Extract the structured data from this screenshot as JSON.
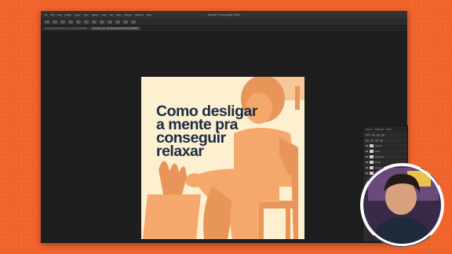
{
  "app": {
    "title": "Adobe Photoshop 2022",
    "menu": [
      "Ps",
      "File",
      "Edit",
      "Image",
      "Layer",
      "Type",
      "Select",
      "Filter",
      "3D",
      "View",
      "Plugins",
      "Window",
      "Help"
    ]
  },
  "tabs": [
    {
      "label": "Carrossel_Ansiedade_01.psd @ 50% (RGB/8)",
      "active": false
    },
    {
      "label": "carrossel_post_04_Relaxar.psd @ 33.3% (RGB/8)",
      "active": true
    }
  ],
  "artboard": {
    "headline": [
      "Como desligar",
      "a mente pra",
      "conseguir",
      "relaxar"
    ],
    "colors": {
      "background": "#fdf0d0",
      "illustration": "#f5a86b",
      "illustration_dark": "#e8955a",
      "text": "#1c2b45"
    }
  },
  "layers_panel": {
    "tabs": [
      "Layers",
      "Channels",
      "Paths"
    ],
    "filter_label": "Kind",
    "layers": [
      "Group 1",
      "Texto",
      "Ilustracao",
      "Fundo",
      "Layer 1",
      "Background"
    ]
  },
  "colors": {
    "page_background": "#f0642c",
    "window": "#1d1d1d"
  },
  "webcam": {
    "border": "#ffffff"
  }
}
